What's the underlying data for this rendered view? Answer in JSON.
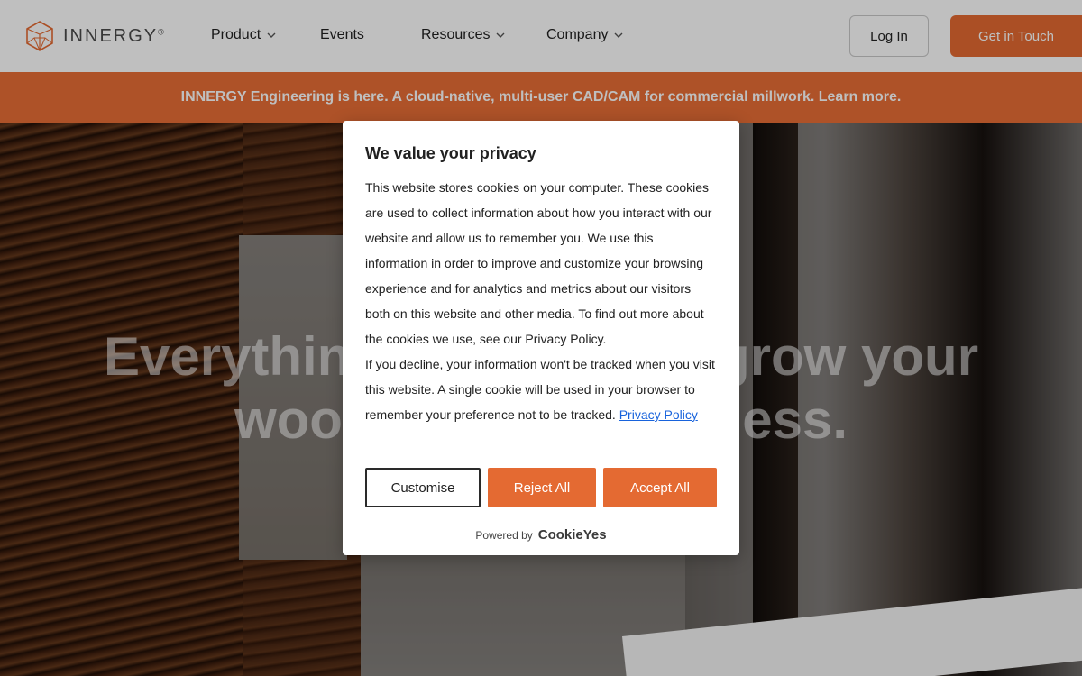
{
  "header": {
    "logo_text": "INNERGY",
    "logo_mark": "®",
    "nav": [
      {
        "label": "Product",
        "has_dropdown": true
      },
      {
        "label": "Events",
        "has_dropdown": false
      },
      {
        "label": "Resources",
        "has_dropdown": true
      },
      {
        "label": "Company",
        "has_dropdown": true
      }
    ],
    "login_label": "Log In",
    "cta_label": "Get in Touch"
  },
  "announcement": {
    "text": "INNERGY Engineering is here. A cloud-native, multi-user CAD/CAM for commercial millwork. Learn more."
  },
  "hero": {
    "title_line1": "Everything you need to grow your",
    "title_line2": "woodworking business."
  },
  "cookie_modal": {
    "title": "We value your privacy",
    "body_p1": "This website stores cookies on your computer. These cookies are used to collect information about how you interact with our website and allow us to remember you. We use this information in order to improve and customize your browsing experience and for analytics and metrics about our visitors both on this website and other media. To find out more about the cookies we use, see our Privacy Policy.",
    "body_p2": "If you decline, your information won't be tracked when you visit this website. A single cookie will be used in your browser to remember your preference not to be tracked.",
    "privacy_link": "Privacy Policy",
    "customise_label": "Customise",
    "reject_label": "Reject All",
    "accept_label": "Accept All",
    "powered_by": "Powered by",
    "powered_brand": "CookieYes"
  },
  "colors": {
    "accent": "#e46a32",
    "link": "#1863dc"
  }
}
